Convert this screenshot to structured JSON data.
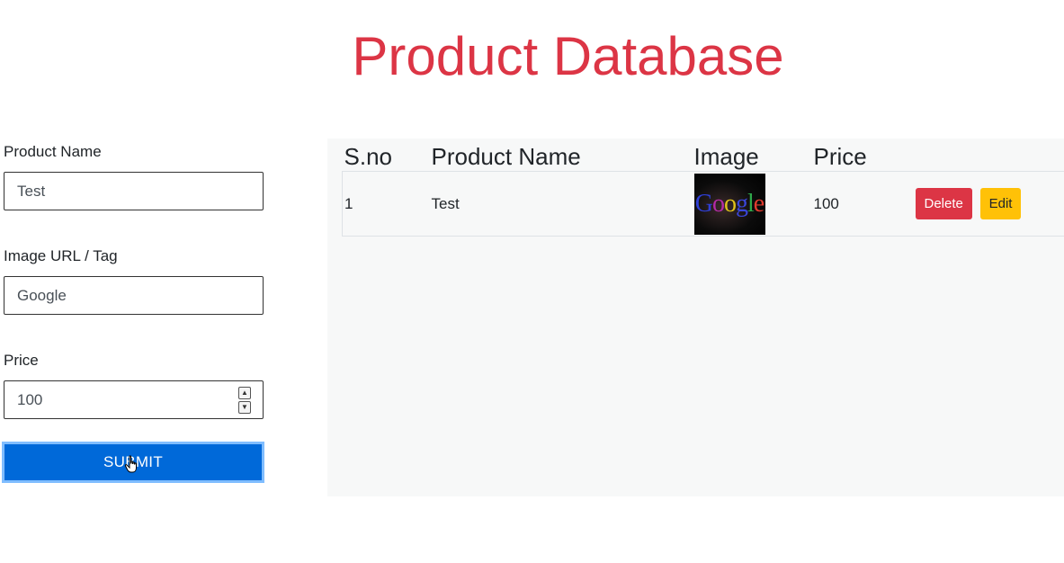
{
  "page": {
    "title": "Product Database"
  },
  "form": {
    "product_name": {
      "label": "Product Name",
      "value": "Test"
    },
    "image": {
      "label": "Image URL / Tag",
      "value": "Google"
    },
    "price": {
      "label": "Price",
      "value": "100"
    },
    "submit_label": "SUBMIT"
  },
  "table": {
    "headers": [
      "S.no",
      "Product Name",
      "Image",
      "Price",
      ""
    ],
    "rows": [
      {
        "sno": "1",
        "name": "Test",
        "image_text": "Google",
        "price": "100",
        "delete_label": "Delete",
        "edit_label": "Edit"
      }
    ]
  },
  "colors": {
    "title": "#dc3545",
    "submit": "#0069d9",
    "delete": "#dc3545",
    "edit": "#ffc107",
    "panel": "#f7f8f8"
  },
  "icons": {
    "cursor": "hand-pointer-icon",
    "spinner_up": "chevron-up-icon",
    "spinner_down": "chevron-down-icon"
  }
}
